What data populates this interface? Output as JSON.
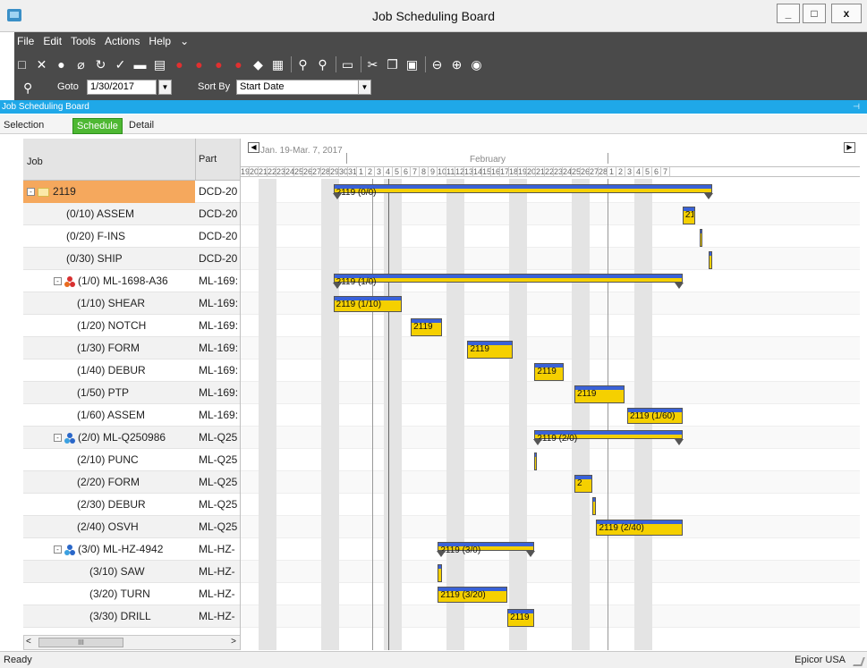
{
  "window": {
    "title": "Job Scheduling Board",
    "controls": [
      "_",
      "□",
      "x"
    ]
  },
  "menu": [
    "File",
    "Edit",
    "Tools",
    "Actions",
    "Help"
  ],
  "menu_more": "⌄",
  "toolbar": {
    "icons": [
      "new-icon",
      "delete-icon",
      "chat-icon",
      "attach-icon",
      "refresh-icon",
      "check-icon",
      "open-icon",
      "clipboard-icon",
      "person-red-icon",
      "person-check-icon",
      "person-red-2-icon",
      "person-check-2-icon",
      "people-icon",
      "calendar-icon",
      "zoom-in-icon",
      "zoom-out-icon",
      "print-icon",
      "cut-icon",
      "copy-icon",
      "paste-icon",
      "back-icon",
      "forward-icon",
      "dial-icon"
    ]
  },
  "goto": {
    "label": "Goto",
    "value": "1/30/2017"
  },
  "sortby": {
    "label": "Sort By",
    "value": "Start Date"
  },
  "panel": {
    "title": "Job Scheduling Board"
  },
  "tabs": [
    {
      "label": "Selection",
      "active": false
    },
    {
      "label": "Schedule",
      "active": true
    },
    {
      "label": "Detail",
      "active": false
    }
  ],
  "grid": {
    "columns": [
      "Job",
      "Part"
    ],
    "rows": [
      {
        "job": "2119",
        "part": "DCD-20",
        "level": 0,
        "kind": "folder",
        "selected": true
      },
      {
        "job": "(0/10) ASSEM",
        "part": "DCD-20",
        "level": 2,
        "kind": "op"
      },
      {
        "job": "(0/20) F-INS",
        "part": "DCD-20",
        "level": 2,
        "kind": "op"
      },
      {
        "job": "(0/30) SHIP",
        "part": "DCD-20",
        "level": 2,
        "kind": "op"
      },
      {
        "job": "(1/0) ML-1698-A36",
        "part": "ML-169:",
        "level": 1,
        "kind": "assembly-red"
      },
      {
        "job": "(1/10) SHEAR",
        "part": "ML-169:",
        "level": 3,
        "kind": "op"
      },
      {
        "job": "(1/20) NOTCH",
        "part": "ML-169:",
        "level": 3,
        "kind": "op"
      },
      {
        "job": "(1/30) FORM",
        "part": "ML-169:",
        "level": 3,
        "kind": "op"
      },
      {
        "job": "(1/40) DEBUR",
        "part": "ML-169:",
        "level": 3,
        "kind": "op"
      },
      {
        "job": "(1/50) PTP",
        "part": "ML-169:",
        "level": 3,
        "kind": "op"
      },
      {
        "job": "(1/60) ASSEM",
        "part": "ML-169:",
        "level": 3,
        "kind": "op"
      },
      {
        "job": "(2/0) ML-Q250986",
        "part": "ML-Q25",
        "level": 1,
        "kind": "assembly-blue"
      },
      {
        "job": "(2/10) PUNC",
        "part": "ML-Q25",
        "level": 3,
        "kind": "op"
      },
      {
        "job": "(2/20) FORM",
        "part": "ML-Q25",
        "level": 3,
        "kind": "op"
      },
      {
        "job": "(2/30) DEBUR",
        "part": "ML-Q25",
        "level": 3,
        "kind": "op"
      },
      {
        "job": "(2/40) OSVH",
        "part": "ML-Q25",
        "level": 3,
        "kind": "op"
      },
      {
        "job": "(3/0) ML-HZ-4942",
        "part": "ML-HZ-",
        "level": 2,
        "kind": "assembly-blue"
      },
      {
        "job": "(3/10) SAW",
        "part": "ML-HZ-",
        "level": 4,
        "kind": "op"
      },
      {
        "job": "(3/20) TURN",
        "part": "ML-HZ-",
        "level": 4,
        "kind": "op"
      },
      {
        "job": "(3/30) DRILL",
        "part": "ML-HZ-",
        "level": 4,
        "kind": "op"
      }
    ]
  },
  "scroll": {
    "left": "<",
    "thumb": "III",
    "right": ">"
  },
  "gantt": {
    "range": "Jan. 19-Mar. 7, 2017",
    "prev": "◀",
    "next": "▶",
    "months": [
      {
        "label": "February",
        "day_index": 13
      }
    ],
    "days": [
      "19",
      "20",
      "21",
      "22",
      "23",
      "24",
      "25",
      "26",
      "27",
      "28",
      "29",
      "30",
      "31",
      "1",
      "2",
      "3",
      "4",
      "5",
      "6",
      "7",
      "8",
      "9",
      "10",
      "11",
      "12",
      "13",
      "14",
      "15",
      "16",
      "17",
      "18",
      "19",
      "20",
      "21",
      "22",
      "23",
      "24",
      "25",
      "26",
      "27",
      "28",
      "1",
      "2",
      "3",
      "4",
      "5",
      "6",
      "7"
    ],
    "today_index": 11,
    "bars": [
      {
        "row": 0,
        "start": 7.2,
        "end": 36.6,
        "label": "2119 (0/0)",
        "summary": true
      },
      {
        "row": 1,
        "start": 34.3,
        "end": 35.3,
        "label": "21"
      },
      {
        "row": 2,
        "start": 35.6,
        "end": 35.8,
        "label": ""
      },
      {
        "row": 3,
        "start": 36.3,
        "end": 36.6,
        "label": ""
      },
      {
        "row": 4,
        "start": 7.2,
        "end": 34.3,
        "label": "2119 (1/0)",
        "summary": true
      },
      {
        "row": 5,
        "start": 7.2,
        "end": 12.5,
        "label": "2119 (1/10)"
      },
      {
        "row": 6,
        "start": 13.2,
        "end": 15.6,
        "label": "2119"
      },
      {
        "row": 7,
        "start": 17.6,
        "end": 21.1,
        "label": "2119"
      },
      {
        "row": 8,
        "start": 22.8,
        "end": 25.1,
        "label": "2119"
      },
      {
        "row": 9,
        "start": 25.9,
        "end": 29.8,
        "label": "2119"
      },
      {
        "row": 10,
        "start": 30.0,
        "end": 34.3,
        "label": "2119 (1/60)"
      },
      {
        "row": 11,
        "start": 22.8,
        "end": 34.3,
        "label": "2119 (2/0)",
        "summary": true
      },
      {
        "row": 12,
        "start": 22.8,
        "end": 23.0,
        "label": ""
      },
      {
        "row": 13,
        "start": 25.9,
        "end": 27.3,
        "label": "2"
      },
      {
        "row": 14,
        "start": 27.3,
        "end": 27.6,
        "label": ""
      },
      {
        "row": 15,
        "start": 27.6,
        "end": 34.3,
        "label": "2119 (2/40)"
      },
      {
        "row": 16,
        "start": 15.3,
        "end": 22.8,
        "label": "2119 (3/0)",
        "summary": true
      },
      {
        "row": 17,
        "start": 15.3,
        "end": 15.6,
        "label": ""
      },
      {
        "row": 18,
        "start": 15.3,
        "end": 20.7,
        "label": "2119 (3/20)"
      },
      {
        "row": 19,
        "start": 20.7,
        "end": 22.8,
        "label": "2119"
      }
    ]
  },
  "status": {
    "left": "Ready",
    "right": "Epicor USA"
  },
  "colors": {
    "panel": "#1fa8e8",
    "tab_active": "#4eb833",
    "bar": "#f5d000",
    "bar_top": "#3a62d8",
    "selected": "#f5a85d"
  }
}
